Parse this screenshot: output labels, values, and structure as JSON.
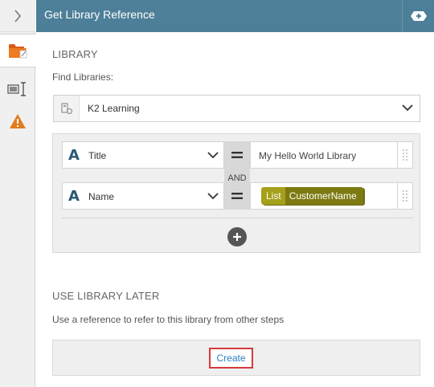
{
  "header": {
    "title": "Get Library Reference",
    "add_icon": "plus-tag-icon"
  },
  "rail": {
    "items": [
      {
        "icon": "chevron-right-icon"
      },
      {
        "icon": "folder-edit-icon",
        "active": true
      },
      {
        "icon": "text-cursor-icon"
      },
      {
        "icon": "warning-icon"
      }
    ]
  },
  "library": {
    "section_title": "LIBRARY",
    "find_label": "Find Libraries:",
    "selected": "K2 Learning"
  },
  "filters": {
    "rows": [
      {
        "field": "Title",
        "operator": "=",
        "value": "My Hello World Library"
      },
      {
        "field": "Name",
        "operator": "=",
        "token_type": "List",
        "token_value": "CustomerName"
      }
    ],
    "join": "AND"
  },
  "use_later": {
    "section_title": "USE LIBRARY LATER",
    "description": "Use a reference to refer to this library from other steps",
    "create_label": "Create"
  },
  "colors": {
    "header_bg": "#4d7f98",
    "warning": "#e07b1f",
    "token_tag": "#a5a01a",
    "token_value": "#7d7a12",
    "link": "#2a7fc3",
    "highlight_border": "#d63a3a"
  }
}
